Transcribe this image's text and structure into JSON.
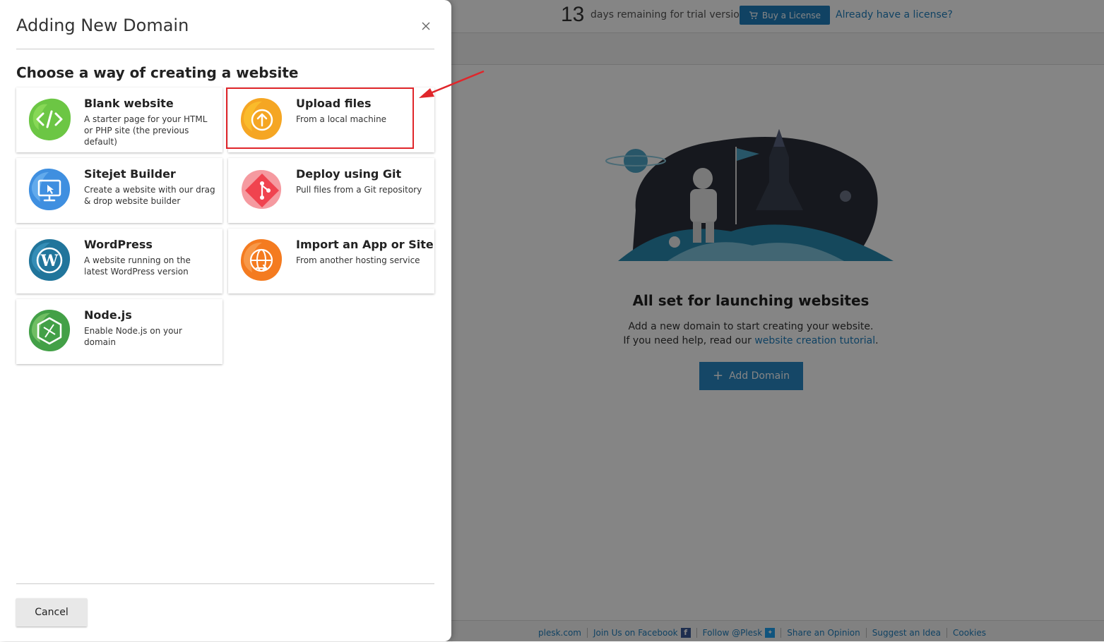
{
  "background": {
    "trial_days": "13",
    "trial_text": "days remaining for trial version",
    "buy_label": "Buy a License",
    "have_license_label": "Already have a license?",
    "empty_title": "All set for launching websites",
    "empty_line1": "Add a new domain to start creating your website.",
    "empty_line2_prefix": "If you need help, read our ",
    "empty_line2_link": "website creation tutorial",
    "empty_line2_suffix": ".",
    "add_domain_label": "Add Domain",
    "footer_links": [
      "plesk.com",
      "Join Us on Facebook",
      "Follow @Plesk",
      "Share an Opinion",
      "Suggest an Idea",
      "Cookies"
    ]
  },
  "drawer": {
    "title": "Adding New Domain",
    "section_title": "Choose a way of creating a website",
    "cancel_label": "Cancel",
    "options": [
      {
        "title": "Blank website",
        "desc": "A starter page for your HTML or PHP site (the previous default)",
        "icon": "code-icon",
        "color": "#6cc644"
      },
      {
        "title": "Upload files",
        "desc": "From a local machine",
        "icon": "upload-arrow-icon",
        "color": "#f5a623"
      },
      {
        "title": "Sitejet Builder",
        "desc": "Create a website with our drag & drop website builder",
        "icon": "monitor-cursor-icon",
        "color": "#3f8fe0"
      },
      {
        "title": "Deploy using Git",
        "desc": "Pull files from a Git repository",
        "icon": "git-icon",
        "color": "#f0434f"
      },
      {
        "title": "WordPress",
        "desc": "A website running on the latest WordPress version",
        "icon": "wordpress-icon",
        "color": "#21759b"
      },
      {
        "title": "Import an App or Site",
        "desc": "From another hosting service",
        "icon": "globe-import-icon",
        "color": "#f47b20"
      },
      {
        "title": "Node.js",
        "desc": "Enable Node.js on your domain",
        "icon": "nodejs-icon",
        "color": "#43a047"
      }
    ]
  },
  "colors": {
    "accent": "#1f7fbf",
    "highlight": "#e0262b"
  }
}
